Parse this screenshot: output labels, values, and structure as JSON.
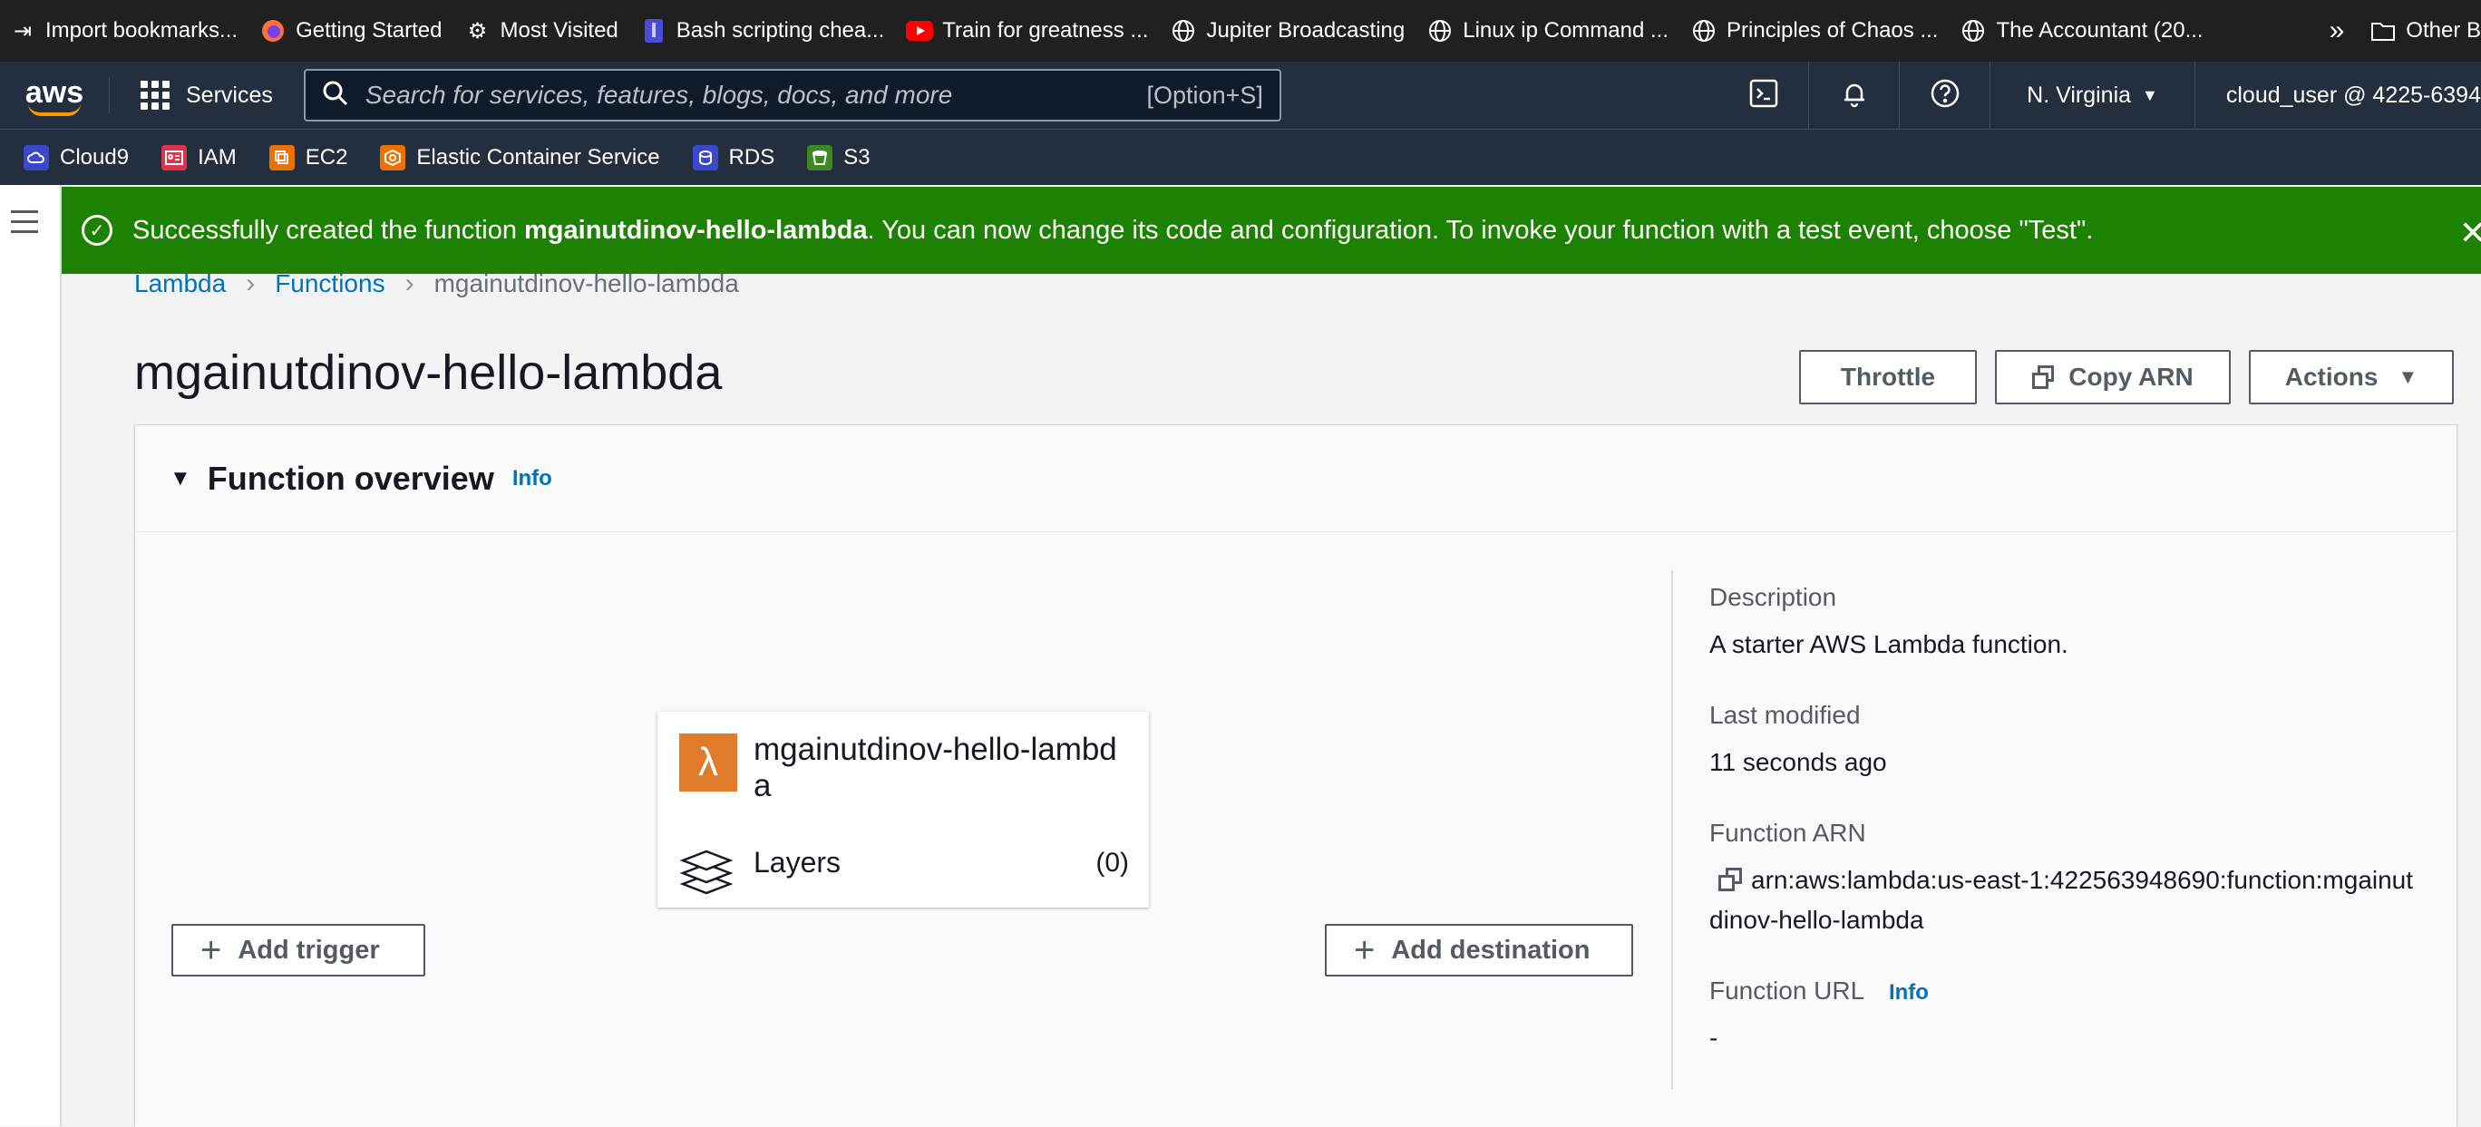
{
  "bookmarks": [
    {
      "icon": "import-icon",
      "label": "Import bookmarks..."
    },
    {
      "icon": "firefox-icon",
      "label": "Getting Started"
    },
    {
      "icon": "gear-icon",
      "label": "Most Visited"
    },
    {
      "icon": "bash-icon",
      "label": "Bash scripting chea..."
    },
    {
      "icon": "youtube-icon",
      "label": "Train for greatness ..."
    },
    {
      "icon": "globe-icon",
      "label": "Jupiter Broadcasting"
    },
    {
      "icon": "globe-icon",
      "label": "Linux ip Command ..."
    },
    {
      "icon": "globe-icon",
      "label": "Principles of Chaos ..."
    },
    {
      "icon": "globe-icon",
      "label": "The Accountant (20..."
    }
  ],
  "bookmarks_other": "Other B",
  "aws_nav": {
    "logo": "aws",
    "services_label": "Services",
    "search_placeholder": "Search for services, features, blogs, docs, and more",
    "search_shortcut": "[Option+S]",
    "region": "N. Virginia",
    "user": "cloud_user @ 4225-6394"
  },
  "favorites": [
    {
      "label": "Cloud9",
      "color": "#3b48cc"
    },
    {
      "label": "IAM",
      "color": "#dd344c"
    },
    {
      "label": "EC2",
      "color": "#ed7100"
    },
    {
      "label": "Elastic Container Service",
      "color": "#ed7100"
    },
    {
      "label": "RDS",
      "color": "#3b48cc"
    },
    {
      "label": "S3",
      "color": "#3f8624"
    }
  ],
  "flash": {
    "prefix": "Successfully created the function ",
    "fn_name": "mgainutdinov-hello-lambda",
    "suffix": ". You can now change its code and configuration. To invoke your function with a test event, choose \"Test\".",
    "color": "#1d8102"
  },
  "breadcrumb": {
    "lambda": "Lambda",
    "functions": "Functions",
    "current": "mgainutdinov-hello-lambda"
  },
  "page": {
    "title": "mgainutdinov-hello-lambda",
    "throttle": "Throttle",
    "copy_arn": "Copy ARN",
    "actions": "Actions"
  },
  "overview": {
    "heading": "Function overview",
    "info": "Info",
    "fn_name": "mgainutdinov-hello-lambda",
    "layers_label": "Layers",
    "layers_count": "(0)",
    "add_trigger": "Add trigger",
    "add_destination": "Add destination",
    "description_label": "Description",
    "description_value": "A starter AWS Lambda function.",
    "last_modified_label": "Last modified",
    "last_modified_value": "11 seconds ago",
    "arn_label": "Function ARN",
    "arn_value": "arn:aws:lambda:us-east-1:422563948690:function:mgainutdinov-hello-lambda",
    "url_label": "Function URL",
    "url_info": "Info",
    "url_value": "-"
  }
}
